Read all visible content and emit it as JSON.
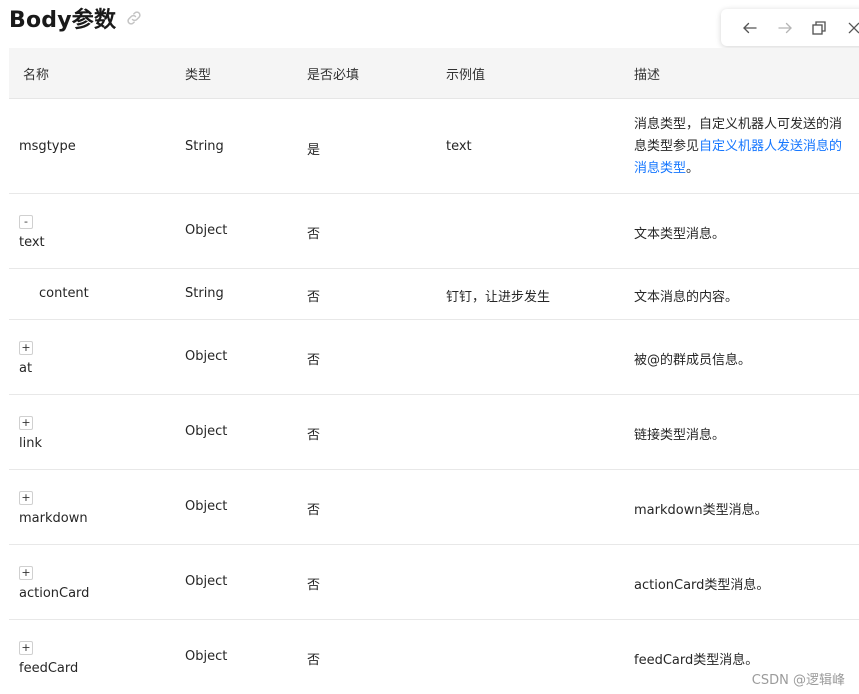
{
  "page": {
    "title": "Body参数",
    "icons": {
      "title_link": "link-icon"
    }
  },
  "toolbar": {
    "icons": [
      "arrow-left-icon",
      "arrow-right-icon",
      "restore-window-icon",
      "close-icon"
    ]
  },
  "table": {
    "headers": [
      "名称",
      "类型",
      "是否必填",
      "示例值",
      "描述"
    ],
    "rows": [
      {
        "toggle": "",
        "name": "msgtype",
        "type": "String",
        "required": "是",
        "example": "text",
        "desc_prefix": "消息类型，自定义机器人可发送的消息类型参见",
        "desc_link": "自定义机器人发送消息的消息类型",
        "desc_suffix": "。"
      },
      {
        "toggle": "-",
        "name": "text",
        "type": "Object",
        "required": "否",
        "example": "",
        "desc": "文本类型消息。"
      },
      {
        "toggle": "",
        "name": "content",
        "type": "String",
        "required": "否",
        "example": "钉钉，让进步发生",
        "desc": "文本消息的内容。"
      },
      {
        "toggle": "+",
        "name": "at",
        "type": "Object",
        "required": "否",
        "example": "",
        "desc": "被@的群成员信息。"
      },
      {
        "toggle": "+",
        "name": "link",
        "type": "Object",
        "required": "否",
        "example": "",
        "desc": "链接类型消息。"
      },
      {
        "toggle": "+",
        "name": "markdown",
        "type": "Object",
        "required": "否",
        "example": "",
        "desc": "markdown类型消息。"
      },
      {
        "toggle": "+",
        "name": "actionCard",
        "type": "Object",
        "required": "否",
        "example": "",
        "desc": "actionCard类型消息。"
      },
      {
        "toggle": "+",
        "name": "feedCard",
        "type": "Object",
        "required": "否",
        "example": "",
        "desc": "feedCard类型消息。"
      }
    ]
  },
  "watermark": "CSDN @逻辑峰"
}
